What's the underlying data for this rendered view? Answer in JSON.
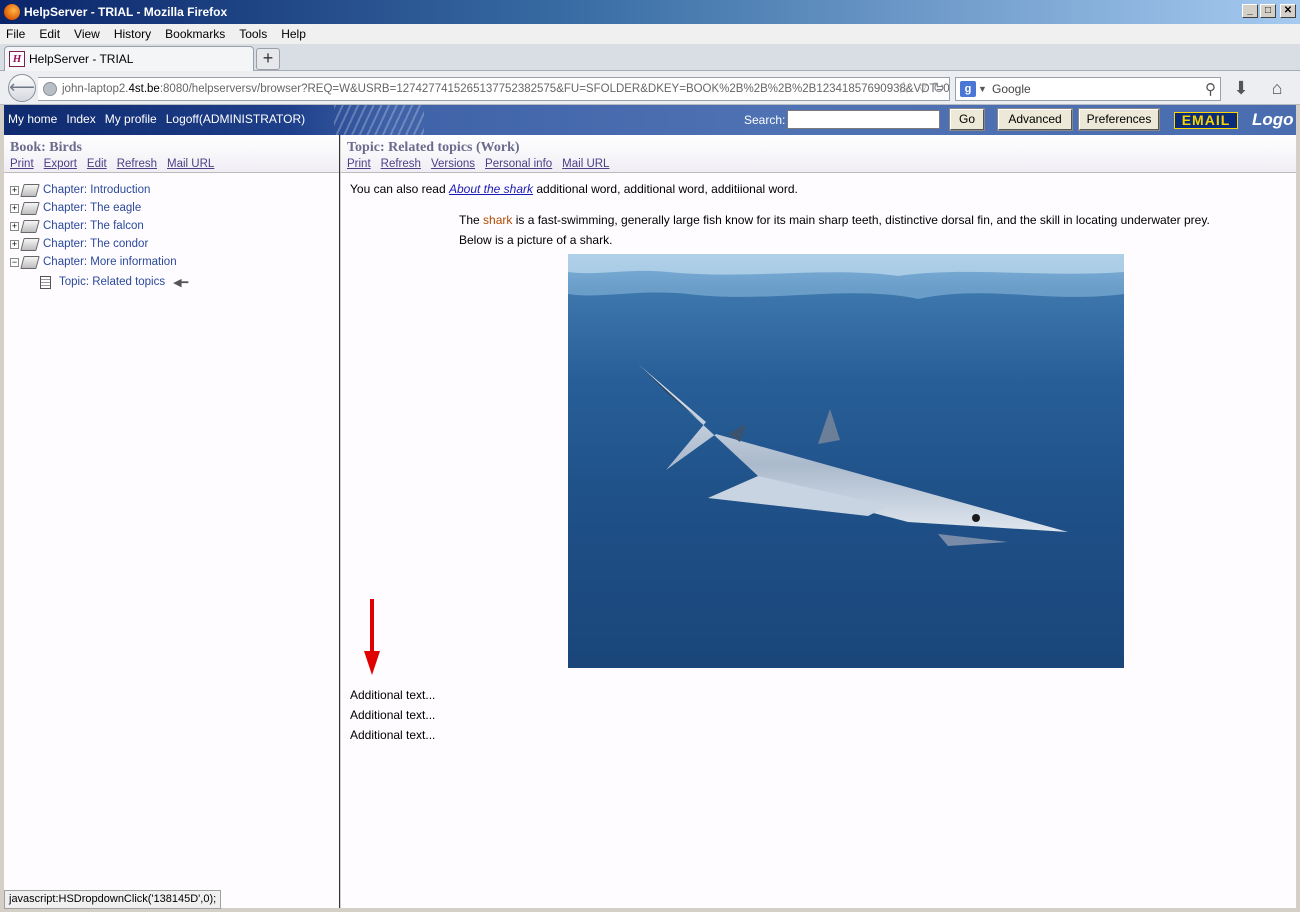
{
  "window": {
    "title": "HelpServer - TRIAL - Mozilla Firefox",
    "controls": [
      "_",
      "□",
      "✕"
    ]
  },
  "menu": [
    "File",
    "Edit",
    "View",
    "History",
    "Bookmarks",
    "Tools",
    "Help"
  ],
  "tab": {
    "label": "HelpServer - TRIAL",
    "favicon": "H",
    "new_tab": "+"
  },
  "address": {
    "prefix": "john-laptop2.",
    "host": "4st.be",
    "rest": ":8080/helpserversv/browser?REQ=W&USRB=1274277415265137752382575&FU=SFOLDER&DKEY=BOOK%2B%2B%2B%2B12341857690938&VDT=0"
  },
  "websearch": {
    "placeholder": "Google",
    "engine": "g"
  },
  "header": {
    "links": [
      "My home",
      "Index",
      "My profile",
      "Logoff(ADMINISTRATOR)"
    ],
    "search_label": "Search:",
    "go": "Go",
    "advanced": "Advanced",
    "preferences": "Preferences",
    "email": "EMAIL",
    "logo": "Logo"
  },
  "left": {
    "title": "Book: Birds",
    "links": [
      "Print",
      "Export",
      "Edit",
      "Refresh",
      "Mail URL"
    ],
    "chapters": [
      "Chapter: Introduction",
      "Chapter: The eagle",
      "Chapter: The falcon",
      "Chapter: The condor",
      "Chapter: More information"
    ],
    "topic": "Topic: Related topics"
  },
  "right": {
    "title": "Topic: Related topics (Work)",
    "links": [
      "Print",
      "Refresh",
      "Versions",
      "Personal info",
      "Mail URL"
    ],
    "line1_pre": "You can also read ",
    "line1_link": "About the shark",
    "line1_post": " additional word, additional word, additiional word.",
    "para_pre": "The ",
    "para_word": "shark",
    "para_post": " is a fast-swimming, generally large fish know for its main sharp teeth, distinctive dorsal fin, and the skill in locating underwater prey.",
    "para2": "Below is a picture of a shark.",
    "additional": [
      "Additional text...",
      "Additional text...",
      "Additional text..."
    ]
  },
  "status": "javascript:HSDropdownClick('138145D',0);"
}
